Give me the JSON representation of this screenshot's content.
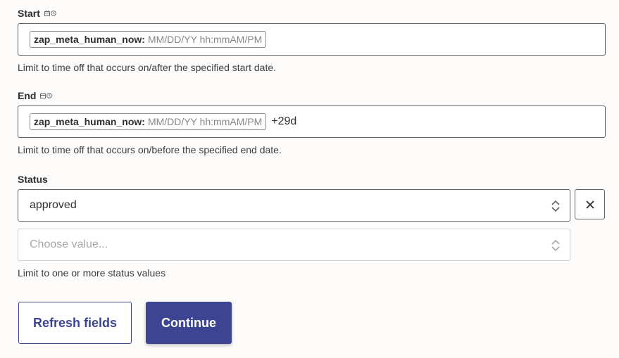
{
  "start": {
    "label": "Start",
    "pill_key": "zap_meta_human_now:",
    "pill_value": "MM/DD/YY hh:mmAM/PM",
    "help": "Limit to time off that occurs on/after the specified start date."
  },
  "end": {
    "label": "End",
    "pill_key": "zap_meta_human_now:",
    "pill_value": "MM/DD/YY hh:mmAM/PM",
    "suffix": "+29d",
    "help": "Limit to time off that occurs on/before the specified end date."
  },
  "status": {
    "label": "Status",
    "selected_value": "approved",
    "placeholder": "Choose value...",
    "help": "Limit to one or more status values"
  },
  "buttons": {
    "refresh": "Refresh fields",
    "continue": "Continue"
  },
  "icons": {
    "date_indicator": "calendar-icon",
    "time_indicator": "clock-icon",
    "select_chevrons": "chevron-up-down-icon",
    "remove": "close-icon"
  },
  "colors": {
    "primary": "#3d4592",
    "background": "#fdfcfa",
    "border": "#5f6164"
  }
}
